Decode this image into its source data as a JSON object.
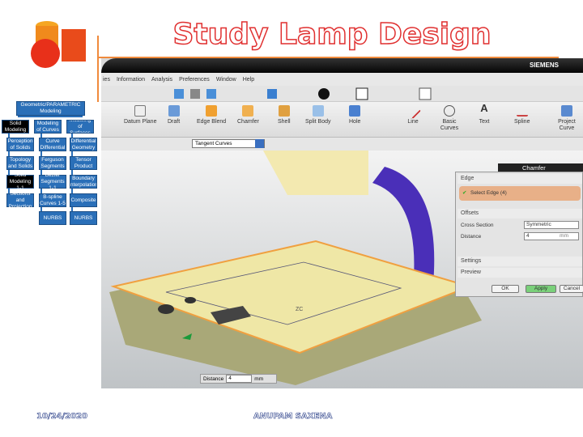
{
  "title": "Study Lamp Design",
  "tree": {
    "root": "Geometric/PARAMETRIC Modeling",
    "columns": [
      {
        "head": "Solid Modeling",
        "items": [
          "Perception of Solids",
          "Topology and Solids",
          "Solid Modeling 1-1",
          "Sections and Projection"
        ]
      },
      {
        "head": "Modeling of Curves",
        "items": [
          "Curve Differential",
          "Ferguson Segments",
          "Bezier Segments 1-1",
          "B-spline Curves 1-5",
          "NURBS"
        ]
      },
      {
        "head": "Modeling of Surfaces",
        "items": [
          "Differential Geometry",
          "Tensor Product",
          "Boundary Interpolation",
          "Composite",
          "NURBS"
        ]
      }
    ]
  },
  "app": {
    "brand": "SIEMENS",
    "menu": [
      "ies",
      "Information",
      "Analysis",
      "Preferences",
      "Window",
      "Help"
    ],
    "tools": [
      "Datum Plane",
      "Draft",
      "Edge Blend",
      "Chamfer",
      "Shell",
      "Split Body",
      "Hole",
      "Line",
      "Basic Curves",
      "Text",
      "Spline",
      "Project Curve"
    ],
    "selection_filter": "Tangent Curves",
    "dialog": {
      "title": "Chamfer",
      "edge_section": "Edge",
      "select_edge": "Select Edge (4)",
      "offsets_section": "Offsets",
      "cross_section_label": "Cross Section",
      "cross_section_value": "Symmetric",
      "distance_label": "Distance",
      "distance_value": "4",
      "unit": "mm",
      "settings": "Settings",
      "preview": "Preview",
      "ok": "OK",
      "apply": "Apply",
      "cancel": "Cancel"
    },
    "onscreen": {
      "label": "Distance",
      "value": "4",
      "unit": "mm"
    },
    "axis": "ZC"
  },
  "footer": {
    "date": "10/24/2020",
    "author": "ANUPAM SAXENA"
  }
}
